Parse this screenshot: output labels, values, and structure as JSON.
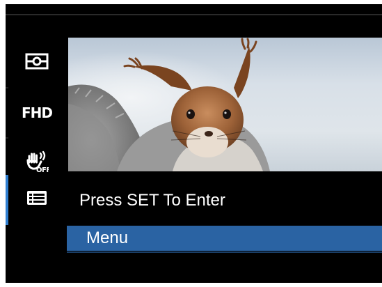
{
  "sidebar": {
    "items": [
      {
        "icon": "metering-icon"
      },
      {
        "label": "FHD",
        "icon": "video-resolution-icon"
      },
      {
        "icon": "stabilization-off-icon",
        "badge": "OFF"
      },
      {
        "icon": "menu-list-icon",
        "active": true
      }
    ]
  },
  "preview": {
    "icon": "squirrel-photo"
  },
  "hint": {
    "text": "Press SET To Enter"
  },
  "menu": {
    "label": "Menu"
  },
  "colors": {
    "background": "#000000",
    "highlight": "#2a63a3",
    "active_indicator": "#2f7fd1",
    "text": "#ffffff"
  }
}
